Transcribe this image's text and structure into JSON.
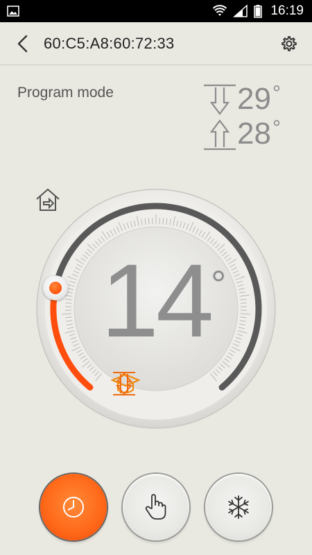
{
  "status_bar": {
    "time": "16:19",
    "icons": [
      "image-icon",
      "wifi-icon",
      "signal-icon",
      "battery-icon"
    ]
  },
  "app_bar": {
    "title": "60:C5:A8:60:72:33",
    "icons": [
      "back-arrow-icon",
      "gear-icon"
    ]
  },
  "mode": {
    "label": "Program mode"
  },
  "setpoints": {
    "cool_value": "29",
    "heat_value": "28",
    "degree_symbol": "°",
    "icons": [
      "cool-down-arrow-icon",
      "heat-up-arrow-icon"
    ]
  },
  "dial": {
    "temperature": "14",
    "unit": "°",
    "level_fraction": 0.22,
    "icons": [
      "home-away-icon",
      "heat-arrow-icon",
      "graduation-cap-icon",
      "cool-arrow-icon"
    ]
  },
  "bottom_buttons": [
    {
      "name": "schedule",
      "icon": "clock-icon",
      "active": true
    },
    {
      "name": "manual",
      "icon": "hand-pointer-icon",
      "active": false
    },
    {
      "name": "cooling",
      "icon": "snowflake-icon",
      "active": false
    }
  ],
  "colors": {
    "accent_orange": "#ff5a12",
    "dial_track": "#555555",
    "background": "#e9e8e1",
    "text_grey": "#8e8e8e"
  }
}
